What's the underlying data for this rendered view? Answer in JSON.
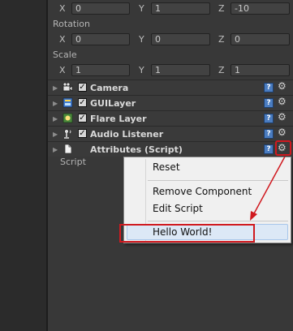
{
  "transform": {
    "position": {
      "x_label": "X",
      "x": "0",
      "y_label": "Y",
      "y": "1",
      "z_label": "Z",
      "z": "-10"
    },
    "rotation_label": "Rotation",
    "rotation": {
      "x_label": "X",
      "x": "0",
      "y_label": "Y",
      "y": "0",
      "z_label": "Z",
      "z": "0"
    },
    "scale_label": "Scale",
    "scale": {
      "x_label": "X",
      "x": "1",
      "y_label": "Y",
      "y": "1",
      "z_label": "Z",
      "z": "1"
    }
  },
  "components": [
    {
      "name": "Camera",
      "checkbox": "✓",
      "icon": "camera-icon"
    },
    {
      "name": "GUILayer",
      "checkbox": "✓",
      "icon": "gui-layer-icon"
    },
    {
      "name": "Flare Layer",
      "checkbox": "✓",
      "icon": "flare-layer-icon"
    },
    {
      "name": "Audio Listener",
      "checkbox": "✓",
      "icon": "audio-listener-icon"
    },
    {
      "name": "Attributes (Script)",
      "icon": "script-file-icon"
    }
  ],
  "script_field_label": "Script",
  "help_glyph": "?",
  "gear_glyph": "⚙",
  "fold_glyph": "▶",
  "context_menu": {
    "items": [
      "Reset",
      "Remove Component",
      "Edit Script",
      "Hello World!"
    ],
    "highlighted": "Hello World!"
  },
  "annotation_color": "#d0191f"
}
